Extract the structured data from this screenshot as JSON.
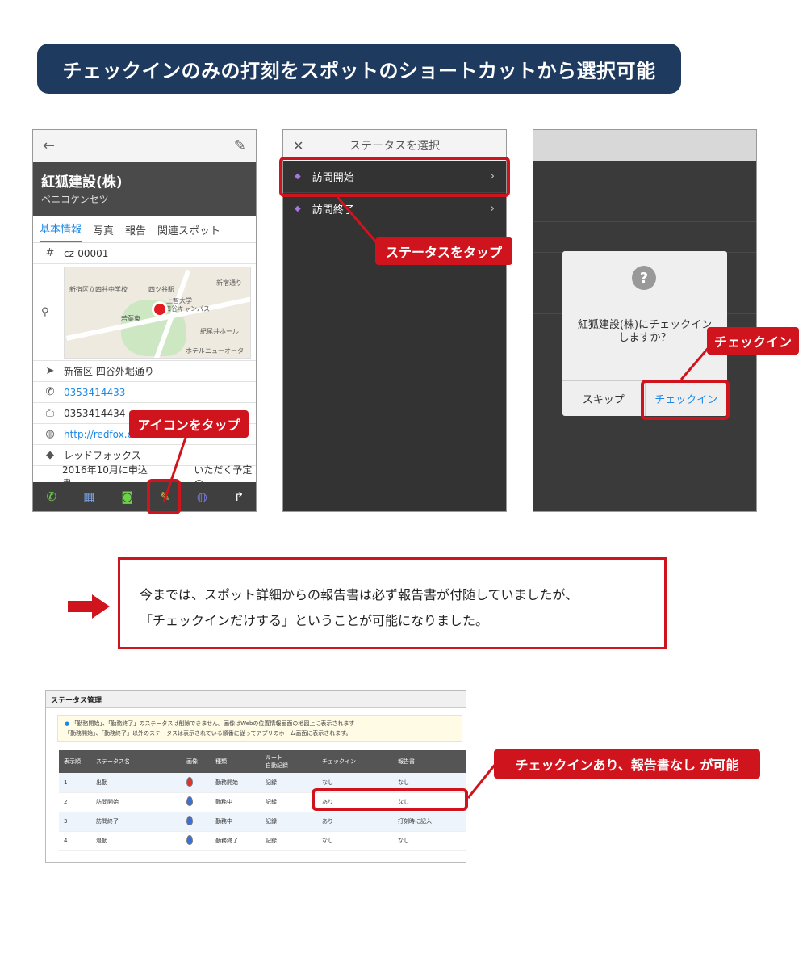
{
  "banner": {
    "title": "チェックインのみの打刻をスポットのショートカットから選択可能"
  },
  "phone1": {
    "back_icon": "←",
    "edit_icon": "✎",
    "spot_name": "紅狐建設(株)",
    "spot_kana": "ベニコケンセツ",
    "tabs": [
      "基本情報",
      "写真",
      "報告",
      "関連スポット"
    ],
    "code": "cz-00001",
    "map_labels": [
      "新宿区立四谷中学校",
      "四ツ谷駅",
      "上智大学",
      "四谷キャンパス",
      "若葉東",
      "紀尾井ホール",
      "ホテルニューオータ",
      "新宿通り"
    ],
    "address": "新宿区 四谷外堀通り",
    "phone": "0353414433",
    "fax": "0353414434",
    "url": "http://redfox.c",
    "company": "レッドフォックス",
    "memo": "2016年10月に申込書",
    "memo_tail": "いただく予定の"
  },
  "phone2": {
    "title": "ステータスを選択",
    "close_icon": "✕",
    "items": [
      {
        "label": "訪問開始"
      },
      {
        "label": "訪問終了"
      }
    ]
  },
  "phone3": {
    "message_line1": "紅狐建設(株)にチェックイン",
    "message_line2": "しますか？",
    "skip_label": "スキップ",
    "checkin_label": "チェックイン"
  },
  "callouts": {
    "tap_icon": "アイコンをタップ",
    "tap_status": "ステータスをタップ",
    "checkin": "チェックイン",
    "checkin_no_report": "チェックインあり、報告書なし が可能"
  },
  "note": {
    "line1": "今までは、スポット詳細からの報告書は必ず報告書が付随していましたが、",
    "line2": "「チェックインだけする」ということが可能になりました。"
  },
  "status_mgmt": {
    "title": "ステータス管理",
    "info_line1": "「勤務開始」、「勤務終了」のステータスは削除できません。画像はWebの位置情報画面の地図上に表示されます",
    "info_line2": "「勤務開始」、「勤務終了」以外のステータスは表示されている順番に従ってアプリのホーム画面に表示されます。",
    "headers": [
      "表示順",
      "ステータス名",
      "画像",
      "種類",
      "ルート",
      "自動記録",
      "チェックイン",
      "報告書"
    ],
    "rows": [
      {
        "order": "1",
        "name": "出勤",
        "marker_color": "#e0322c",
        "kind": "勤務開始",
        "route": "記録",
        "checkin": "なし",
        "report": "なし"
      },
      {
        "order": "2",
        "name": "訪問開始",
        "marker_color": "#3a6fd8",
        "kind": "勤務中",
        "route": "記録",
        "checkin": "あり",
        "report": "なし"
      },
      {
        "order": "3",
        "name": "訪問終了",
        "marker_color": "#3a6fd8",
        "kind": "勤務中",
        "route": "記録",
        "checkin": "あり",
        "report": "打刻時に記入"
      },
      {
        "order": "4",
        "name": "退勤",
        "marker_color": "#3a6fd8",
        "kind": "勤務終了",
        "route": "記録",
        "checkin": "なし",
        "report": "なし"
      }
    ]
  },
  "colors": {
    "navy": "#1e3a5f",
    "red": "#d0141e",
    "link_blue": "#1e88e5",
    "purple_dot": "#a678e0"
  }
}
